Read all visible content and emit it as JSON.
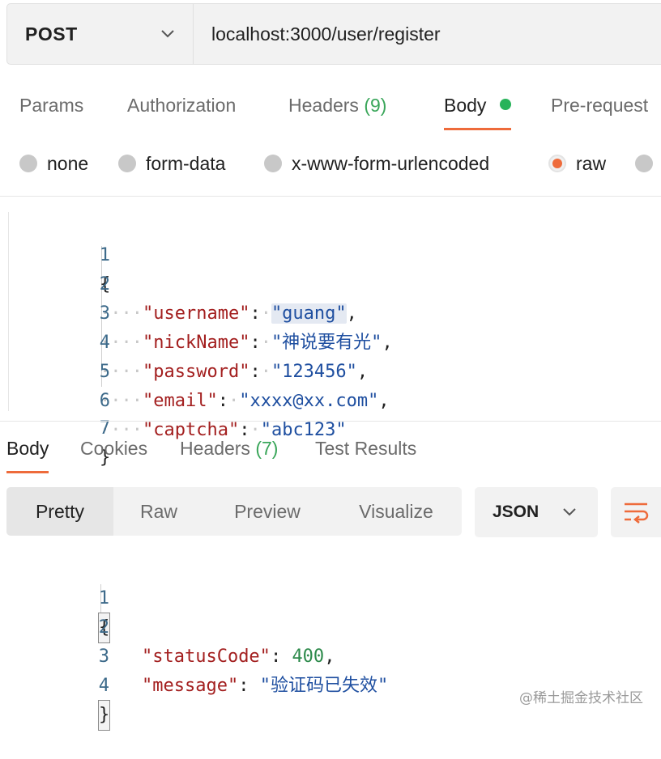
{
  "request": {
    "method": "POST",
    "url": "localhost:3000/user/register"
  },
  "request_tabs": [
    {
      "label": "Params"
    },
    {
      "label": "Authorization"
    },
    {
      "label": "Headers",
      "count": "(9)"
    },
    {
      "label": "Body",
      "active": true
    },
    {
      "label": "Pre-request"
    }
  ],
  "body_types": [
    {
      "label": "none",
      "selected": false
    },
    {
      "label": "form-data",
      "selected": false
    },
    {
      "label": "x-www-form-urlencoded",
      "selected": false
    },
    {
      "label": "raw",
      "selected": true
    }
  ],
  "request_body": {
    "line_numbers": [
      "1",
      "2",
      "3",
      "4",
      "5",
      "6",
      "7"
    ],
    "open_brace": "{",
    "close_brace": "}",
    "fields": [
      {
        "key": "\"username\"",
        "value": "\"guang\""
      },
      {
        "key": "\"nickName\"",
        "value": "\"神说要有光\""
      },
      {
        "key": "\"password\"",
        "value": "\"123456\""
      },
      {
        "key": "\"email\"",
        "value": "\"xxxx@xx.com\""
      },
      {
        "key": "\"captcha\"",
        "value": "\"abc123\""
      }
    ]
  },
  "response_tabs": [
    {
      "label": "Body",
      "active": true
    },
    {
      "label": "Cookies"
    },
    {
      "label": "Headers",
      "count": "(7)"
    },
    {
      "label": "Test Results"
    }
  ],
  "view_modes": [
    "Pretty",
    "Raw",
    "Preview",
    "Visualize"
  ],
  "format": "JSON",
  "response_body": {
    "line_numbers": [
      "1",
      "2",
      "3",
      "4"
    ],
    "open_brace": "{",
    "close_brace": "}",
    "status_key": "\"statusCode\"",
    "status_value": "400",
    "message_key": "\"message\"",
    "message_value": "\"验证码已失效\""
  },
  "watermark": "@稀土掘金技术社区",
  "colors": {
    "accent": "#ee6b3b",
    "success": "#28b35a",
    "json_key": "#a31f1f",
    "json_string": "#1f4fa0",
    "json_number": "#2d8a4b"
  }
}
